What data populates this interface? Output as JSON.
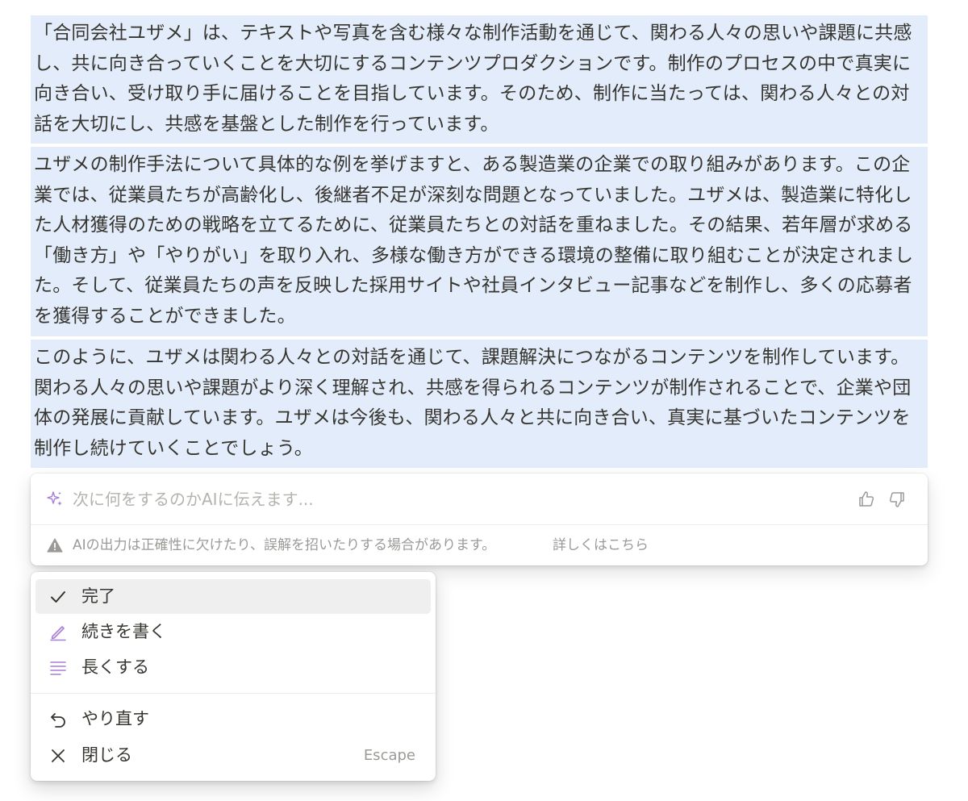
{
  "document": {
    "paragraphs": [
      "「合同会社ユザメ」は、テキストや写真を含む様々な制作活動を通じて、関わる人々の思いや課題に共感し、共に向き合っていくことを大切にするコンテンツプロダクションです。制作のプロセスの中で真実に向き合い、受け取り手に届けることを目指しています。そのため、制作に当たっては、関わる人々との対話を大切にし、共感を基盤とした制作を行っています。",
      "ユザメの制作手法について具体的な例を挙げますと、ある製造業の企業での取り組みがあります。この企業では、従業員たちが高齢化し、後継者不足が深刻な問題となっていました。ユザメは、製造業に特化した人材獲得のための戦略を立てるために、従業員たちとの対話を重ねました。その結果、若年層が求める「働き方」や「やりがい」を取り入れ、多様な働き方ができる環境の整備に取り組むことが決定されました。そして、従業員たちの声を反映した採用サイトや社員インタビュー記事などを制作し、多くの応募者を獲得することができました。",
      "このように、ユザメは関わる人々との対話を通じて、課題解決につながるコンテンツを制作しています。関わる人々の思いや課題がより深く理解され、共感を得られるコンテンツが制作されることで、企業や団体の発展に貢献しています。ユザメは今後も、関わる人々と共に向き合い、真実に基づいたコンテンツを制作し続けていくことでしょう。"
    ]
  },
  "ai_prompt": {
    "placeholder": "次に何をするのかAIに伝えます...",
    "value": "",
    "notice": "AIの出力は正確性に欠けたり、誤解を招いたりする場合があります。",
    "notice_link": "詳しくはこちら"
  },
  "menu": {
    "items": [
      {
        "label": "完了",
        "icon": "check-icon",
        "selected": true
      },
      {
        "label": "続きを書く",
        "icon": "pencil-line-icon"
      },
      {
        "label": "長くする",
        "icon": "lines-icon"
      },
      {
        "label": "やり直す",
        "icon": "undo-arrow-icon"
      },
      {
        "label": "閉じる",
        "icon": "close-icon",
        "shortcut": "Escape"
      }
    ]
  },
  "colors": {
    "selection_bg": "#e2ecfa",
    "ai_accent": "#a87ed6",
    "text": "#37352f",
    "muted": "#9b9a97"
  }
}
